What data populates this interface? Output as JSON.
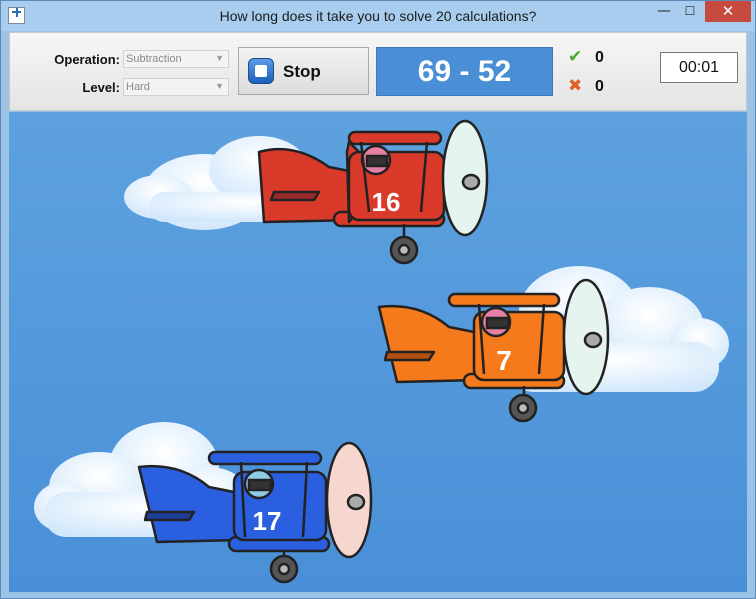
{
  "window": {
    "title": "How long does it take you to solve 20 calculations?",
    "minimize_glyph": "—",
    "maximize_glyph": "☐",
    "close_glyph": "✕"
  },
  "toolbar": {
    "operation_label": "Operation:",
    "operation_value": "Subtraction",
    "level_label": "Level:",
    "level_value": "Hard",
    "stop_label": "Stop",
    "problem": "69 - 52",
    "correct_count": "0",
    "wrong_count": "0",
    "timer": "00:01"
  },
  "planes": [
    {
      "color": "red",
      "answer": "16"
    },
    {
      "color": "orange",
      "answer": "7"
    },
    {
      "color": "blue",
      "answer": "17"
    }
  ],
  "colors": {
    "sky": "#4a90d8",
    "problem_bg": "#4a8fd6",
    "red_plane": "#d93a2a",
    "orange_plane": "#f57a1c",
    "blue_plane": "#2a5fe0",
    "correct": "#49a82e",
    "wrong": "#e06127"
  },
  "icons": [
    "app-icon",
    "stop-icon",
    "check-icon",
    "cross-icon"
  ]
}
